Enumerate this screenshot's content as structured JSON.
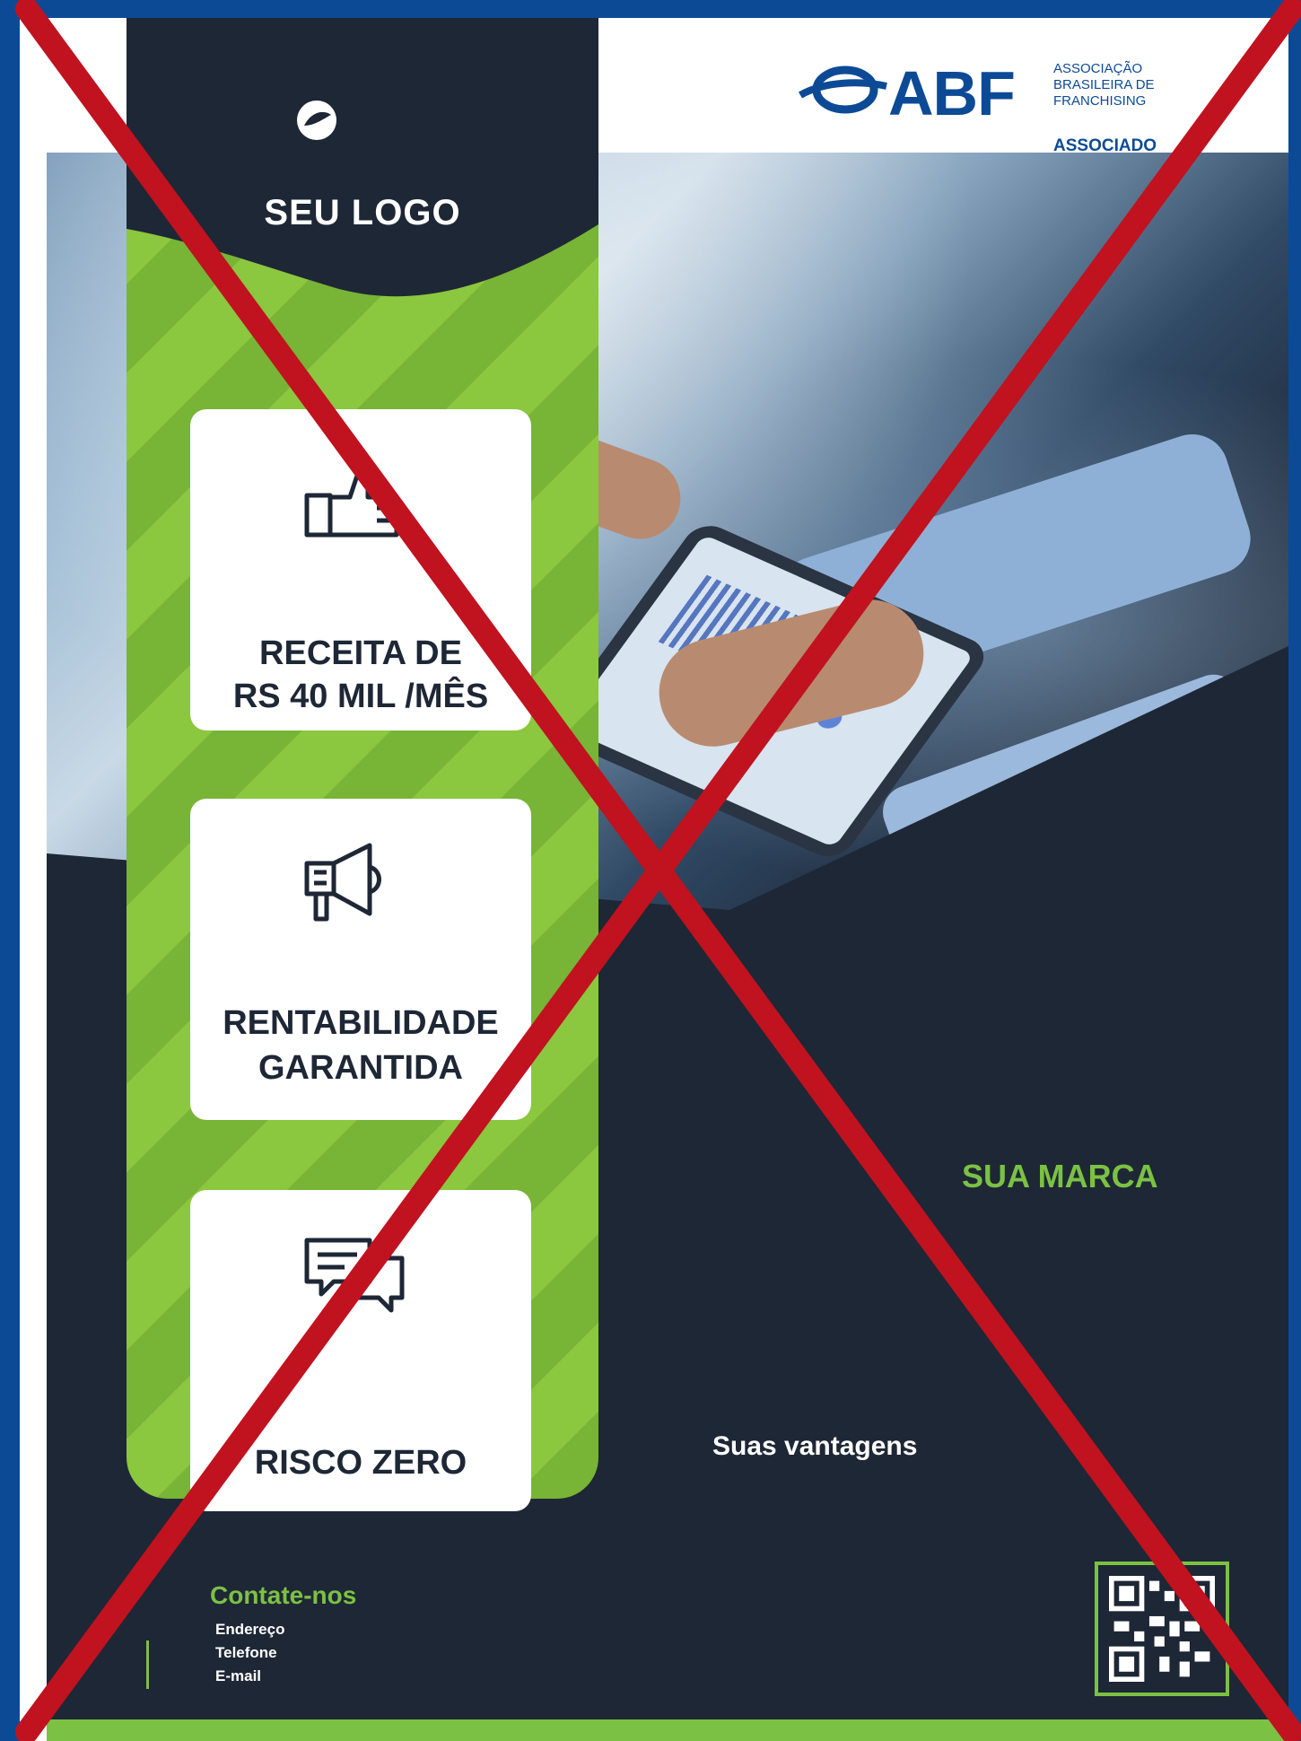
{
  "badge": {
    "org_name": "ABF",
    "org_line1": "ASSOCIAÇÃO",
    "org_line2": "BRASILEIRA DE",
    "org_line3": "FRANCHISING",
    "tag": "ASSOCIADO"
  },
  "flyer": {
    "logo_text": "SEU LOGO",
    "cards": [
      {
        "icon": "thumbs-up-icon",
        "label_line1": "RECEITA DE",
        "label_line2": "RS 40 MIL /MÊS"
      },
      {
        "icon": "megaphone-icon",
        "label_line1": "RENTABILIDADE",
        "label_line2": "GARANTIDA"
      },
      {
        "icon": "chat-bubbles-icon",
        "label_line1": "RISCO ZERO",
        "label_line2": ""
      }
    ],
    "brand": "SUA MARCA",
    "advantages": "Suas vantagens",
    "contact": {
      "title": "Contate-nos",
      "lines": [
        "Endereço",
        "Telefone",
        "E-mail"
      ]
    }
  },
  "colors": {
    "border_blue": "#0d4a96",
    "dark_navy": "#1e2735",
    "green": "#7bc143",
    "cross_red": "#c1121f"
  }
}
